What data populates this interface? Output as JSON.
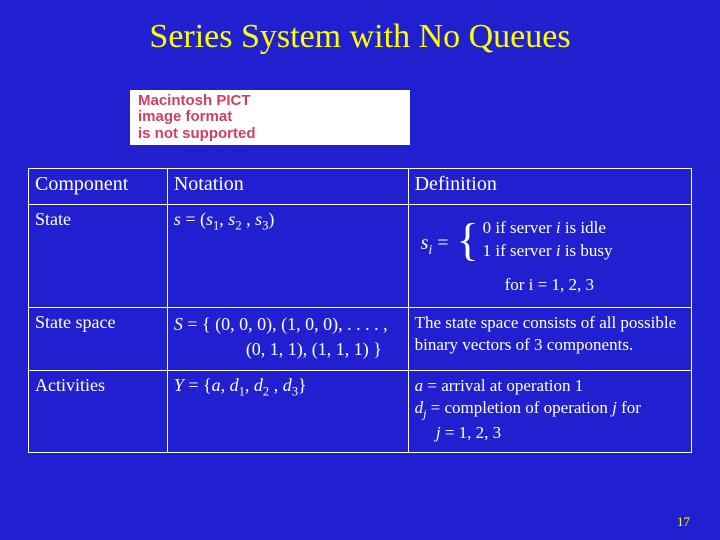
{
  "title": "Series System with No Queues",
  "placeholder": {
    "l1": "Macintosh PICT",
    "l2": "image format",
    "l3": "is not supported"
  },
  "headers": {
    "c1": "Component",
    "c2": "Notation",
    "c3": "Definition"
  },
  "state": {
    "label": "State",
    "notation_prefix": "s",
    "notation_eq": " = (",
    "n_s1": "s",
    "n_s1sub": "1",
    "n_sep1": ", ",
    "n_s2": "s",
    "n_s2sub": "2",
    "n_sep2": " , ",
    "n_s3": "s",
    "n_s3sub": "3",
    "n_close": ")",
    "si_s": "s",
    "si_sub": "i",
    "si_eq": " =",
    "case0a": "0  if server ",
    "case0i": "i",
    "case0b": " is idle",
    "case1a": "1  if server ",
    "case1i": "i",
    "case1b": " is busy",
    "for": "for i = 1, 2, 3"
  },
  "sspace": {
    "label": "State space",
    "n_S": "S",
    "n_line1": " = { (0, 0, 0), (1, 0, 0), . . . . ,",
    "n_line2": "(0, 1, 1), (1, 1, 1) }",
    "def": "The state space consists of all possible binary vectors of 3 components."
  },
  "act": {
    "label": "Activities",
    "n_Y": "Y",
    "n_eq": " = {",
    "n_a": "a",
    "n_c1": ", ",
    "n_d1": "d",
    "n_d1s": "1",
    "n_c2": ", ",
    "n_d2": "d",
    "n_d2s": "2",
    "n_c3": " , ",
    "n_d3": "d",
    "n_d3s": "3",
    "n_close": "}",
    "def_a1": "a",
    "def_a2": " =  arrival at operation 1",
    "def_d1": "d",
    "def_d1s": "j",
    "def_d2": " = completion of operation ",
    "def_d2j": "j",
    "def_d3": " for",
    "def_jline": "j",
    "def_jvals": " = 1, 2, 3"
  },
  "page": "17"
}
